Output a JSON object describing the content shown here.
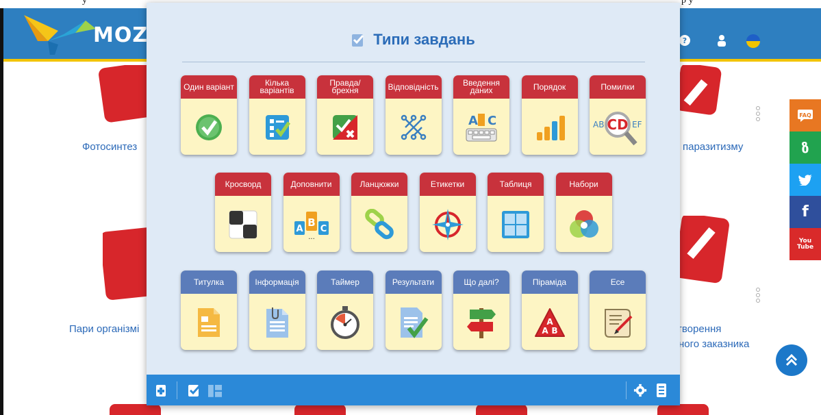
{
  "top_strip": {
    "left_text": "у",
    "right_text": "р у"
  },
  "header": {
    "logo_text": "MOZA",
    "accent": "#2e7fc0",
    "yellow": "#f2c400"
  },
  "background": {
    "labels": [
      "Фотосинтез",
      "паразитизму",
      "Пари організмі",
      "творення",
      "ного заказника"
    ]
  },
  "social": [
    {
      "name": "FAQ",
      "color": "#e87722"
    },
    {
      "name": "ზ",
      "color": "#21a34f"
    },
    {
      "name": "twitter",
      "color": "#1da1f2"
    },
    {
      "name": "f",
      "color": "#2f4f9c"
    },
    {
      "name": "You Tube",
      "color": "#d92a2a"
    }
  ],
  "modal": {
    "title": "Типи завдань",
    "rows": [
      [
        {
          "label": "Один варіант",
          "kind": "red",
          "icon": "check-circle-icon"
        },
        {
          "label": "Кілька варіантів",
          "kind": "red",
          "icon": "checklist-icon"
        },
        {
          "label": "Правда/брехня",
          "kind": "red",
          "icon": "true-false-icon"
        },
        {
          "label": "Відповідність",
          "kind": "red",
          "icon": "match-icon"
        },
        {
          "label": "Введення даних",
          "kind": "red",
          "icon": "keyboard-icon"
        },
        {
          "label": "Порядок",
          "kind": "red",
          "icon": "bar-order-icon"
        },
        {
          "label": "Помилки",
          "kind": "red",
          "icon": "magnifier-icon"
        }
      ],
      [
        {
          "label": "Кросворд",
          "kind": "red",
          "icon": "crossword-icon"
        },
        {
          "label": "Доповнити",
          "kind": "red",
          "icon": "abc-blocks-icon"
        },
        {
          "label": "Ланцюжки",
          "kind": "red",
          "icon": "chain-icon"
        },
        {
          "label": "Етикетки",
          "kind": "red",
          "icon": "compass-icon"
        },
        {
          "label": "Таблиця",
          "kind": "red",
          "icon": "table-icon"
        },
        {
          "label": "Набори",
          "kind": "red",
          "icon": "venn-icon"
        }
      ],
      [
        {
          "label": "Титулка",
          "kind": "blue",
          "icon": "document-icon"
        },
        {
          "label": "Інформація",
          "kind": "blue",
          "icon": "clip-document-icon"
        },
        {
          "label": "Таймер",
          "kind": "blue",
          "icon": "stopwatch-icon"
        },
        {
          "label": "Результати",
          "kind": "blue",
          "icon": "results-icon"
        },
        {
          "label": "Що далі?",
          "kind": "blue",
          "icon": "signpost-icon"
        },
        {
          "label": "Піраміда",
          "kind": "blue",
          "icon": "pyramid-icon"
        },
        {
          "label": "Есе",
          "kind": "blue",
          "icon": "scroll-icon"
        }
      ]
    ]
  },
  "footer": {
    "accent": "#2b89d8"
  }
}
